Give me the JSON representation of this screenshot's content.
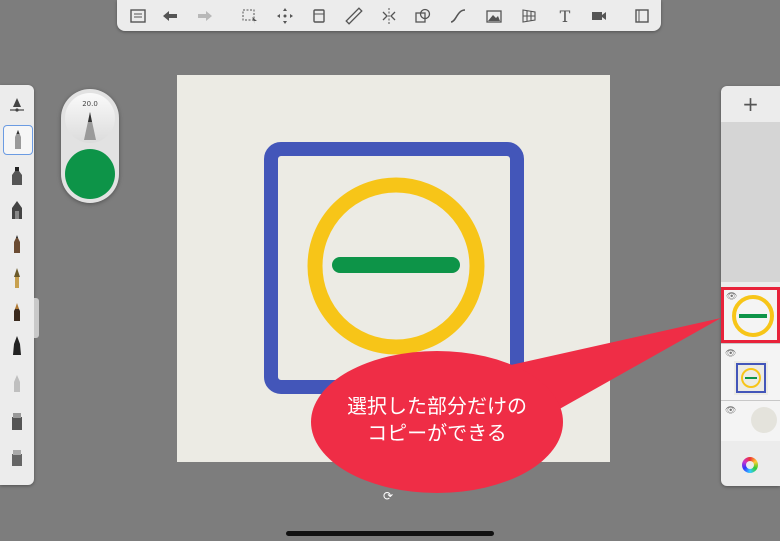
{
  "toolbar": {
    "icons": [
      "list-icon",
      "undo-icon",
      "redo-icon",
      "selection-icon",
      "transform-icon",
      "crop-icon",
      "ruler-icon",
      "symmetry-icon",
      "shape-icon",
      "curve-icon",
      "image-import-icon",
      "perspective-icon",
      "text-icon",
      "video-icon",
      "fullscreen-icon"
    ]
  },
  "brush_puck": {
    "size_value": "20.0",
    "color": "#0d9448"
  },
  "canvas": {
    "background": "#ecebe4",
    "square_color": "#4356b9",
    "circle_color": "#f7c518",
    "bar_color": "#0d9448"
  },
  "layers_panel": {
    "add_label": "+",
    "layer_count": 3
  },
  "callout": {
    "line1": "選択した部分だけの",
    "line2": "コピーができる",
    "color": "#ef2d46"
  }
}
